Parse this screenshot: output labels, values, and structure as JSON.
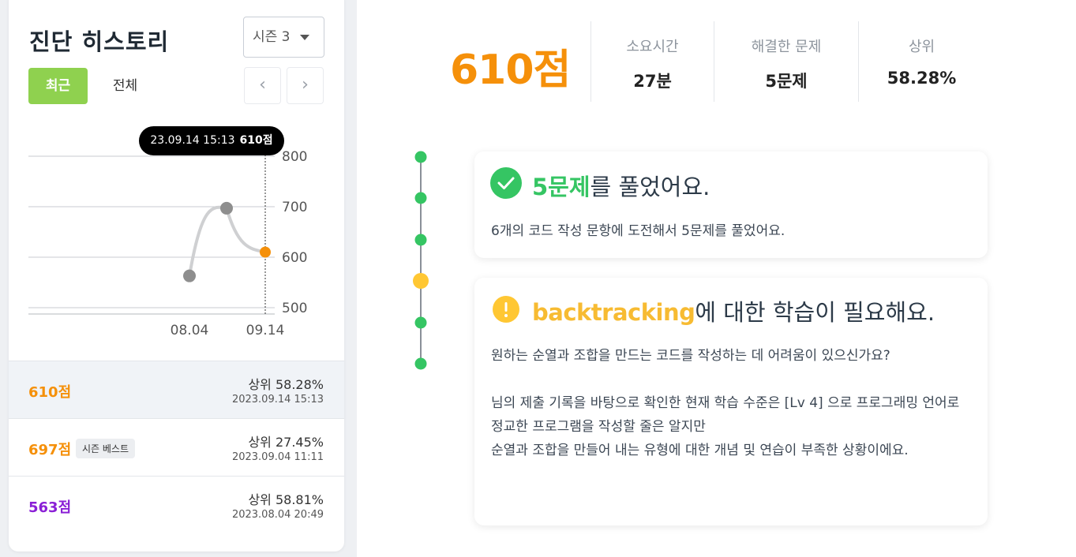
{
  "history": {
    "title": "진단 히스토리",
    "season_selected": "시즌 3",
    "tabs": {
      "recent": "최근",
      "all": "전체"
    },
    "nav": {
      "prev": "‹",
      "next": "›"
    },
    "tooltip": {
      "date": "23.09.14 15:13",
      "score": "610점"
    },
    "records": [
      {
        "score": "610점",
        "score_color": "#f5900a",
        "badge": "",
        "rank": "상위 58.28%",
        "date": "2023.09.14 15:13",
        "active": true
      },
      {
        "score": "697점",
        "score_color": "#f5900a",
        "badge": "시즌 베스트",
        "rank": "상위 27.45%",
        "date": "2023.09.04 11:11",
        "active": false
      },
      {
        "score": "563점",
        "score_color": "#8a1fd6",
        "badge": "",
        "rank": "상위 58.81%",
        "date": "2023.08.04 20:49",
        "active": false
      }
    ]
  },
  "chart_data": {
    "type": "line",
    "x_ticks": [
      "08.04",
      "09.14"
    ],
    "y_ticks": [
      500,
      600,
      700,
      800
    ],
    "ylim": [
      500,
      800
    ],
    "points": [
      {
        "label": "08.04",
        "value": 563
      },
      {
        "label": "09.04",
        "value": 697
      },
      {
        "label": "09.14",
        "value": 610
      }
    ],
    "highlight_color": "#f5900a",
    "point_color": "#8e8e8e"
  },
  "summary": {
    "score": "610점",
    "stats": [
      {
        "label": "소요시간",
        "value": "27분"
      },
      {
        "label": "해결한 문제",
        "value": "5문제"
      },
      {
        "label": "상위",
        "value": "58.28%"
      }
    ]
  },
  "messages": [
    {
      "icon": "check-circle-icon",
      "highlight": "5문제",
      "title_rest": "를 풀었어요.",
      "body": "6개의 코드 작성 문항에 도전해서 5문제를 풀었어요."
    },
    {
      "icon": "exclamation-circle-icon",
      "highlight": "backtracking",
      "title_rest": "에 대한 학습이 필요해요.",
      "body": "원하는 순열과 조합을 만드는 코드를 작성하는 데 어려움이 있으신가요?\n\n님의 제출 기록을 바탕으로 확인한 현재 학습 수준은 [Lv 4] 으로 프로그래밍 언어로 정교한 프로그램을 작성할 줄은 알지만\n순열과 조합을 만들어 내는 유형에 대한 개념 및 연습이 부족한 상황이에요."
    }
  ],
  "colors": {
    "accent_orange": "#f5900a",
    "green": "#35c563",
    "yellow": "#ffc733",
    "recent_btn": "#8fd14f"
  }
}
